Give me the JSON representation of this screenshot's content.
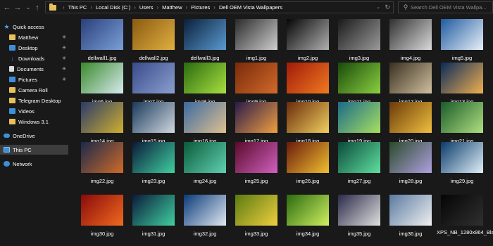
{
  "address": {
    "crumbs": [
      "This PC",
      "Local Disk (C:)",
      "Users",
      "Matthew",
      "Pictures",
      "Dell OEM Vista Wallpapers"
    ]
  },
  "search": {
    "placeholder": "Search Dell OEM Vista Wallpa..."
  },
  "sidebar": {
    "items": [
      {
        "label": "Quick access",
        "icon": "star-icon",
        "pinned": false
      },
      {
        "label": "Matthew",
        "icon": "folder-icon",
        "pinned": true
      },
      {
        "label": "Desktop",
        "icon": "desktop-icon",
        "pinned": true
      },
      {
        "label": "Downloads",
        "icon": "download-icon",
        "pinned": true
      },
      {
        "label": "Documents",
        "icon": "documents-icon",
        "pinned": true
      },
      {
        "label": "Pictures",
        "icon": "pictures-icon",
        "pinned": true
      },
      {
        "label": "Camera Roll",
        "icon": "folder-icon",
        "pinned": false
      },
      {
        "label": "Telegram Desktop",
        "icon": "folder-icon",
        "pinned": false
      },
      {
        "label": "Videos",
        "icon": "videos-icon",
        "pinned": false
      },
      {
        "label": "Windows 3.1",
        "icon": "folder-icon",
        "pinned": false
      },
      {
        "label": "OneDrive",
        "icon": "cloud-icon",
        "pinned": false
      },
      {
        "label": "This PC",
        "icon": "computer-icon",
        "pinned": false,
        "selected": true
      },
      {
        "label": "Network",
        "icon": "network-icon",
        "pinned": false
      }
    ]
  },
  "files": [
    {
      "name": "dellwall1.jpg",
      "colors": [
        "#2a3f7a",
        "#7aa0d8"
      ]
    },
    {
      "name": "dellwall2.jpg",
      "colors": [
        "#8a5a12",
        "#e0b040"
      ]
    },
    {
      "name": "dellwall3.jpg",
      "colors": [
        "#0a1f3a",
        "#5a9ad0"
      ]
    },
    {
      "name": "img1.jpg",
      "colors": [
        "#2a2a2a",
        "#cfcfcf"
      ]
    },
    {
      "name": "img2.jpg",
      "colors": [
        "#050505",
        "#b0b0b0"
      ]
    },
    {
      "name": "img3.jpg",
      "colors": [
        "#1a1a1a",
        "#9a9a9a"
      ]
    },
    {
      "name": "img4.jpg",
      "colors": [
        "#303030",
        "#dadada"
      ]
    },
    {
      "name": "img5.jpg",
      "colors": [
        "#1f5aa0",
        "#e8f0f8"
      ]
    },
    {
      "name": "img6.jpg",
      "colors": [
        "#3a8a2a",
        "#d8eaf0"
      ]
    },
    {
      "name": "img7.jpg",
      "colors": [
        "#3a4a8a",
        "#8aa0d0"
      ]
    },
    {
      "name": "img8.jpg",
      "colors": [
        "#2a6a10",
        "#a8e040"
      ]
    },
    {
      "name": "img9.jpg",
      "colors": [
        "#7a2a0a",
        "#d06a2a"
      ]
    },
    {
      "name": "img10.jpg",
      "colors": [
        "#a01a0a",
        "#f07a20"
      ]
    },
    {
      "name": "img11.jpg",
      "colors": [
        "#1a4a0a",
        "#8ad040"
      ]
    },
    {
      "name": "img12.jpg",
      "colors": [
        "#3a3020",
        "#d0c0a0"
      ]
    },
    {
      "name": "img13.jpg",
      "colors": [
        "#0a2a5a",
        "#f0b050"
      ]
    },
    {
      "name": "img14.jpg",
      "colors": [
        "#2a3a6a",
        "#d0b030"
      ]
    },
    {
      "name": "img15.jpg",
      "colors": [
        "#1a3a5a",
        "#d0d8e0"
      ]
    },
    {
      "name": "img16.jpg",
      "colors": [
        "#3a6aa0",
        "#e0c090"
      ]
    },
    {
      "name": "img17.jpg",
      "colors": [
        "#2a1a4a",
        "#f0a040"
      ]
    },
    {
      "name": "img18.jpg",
      "colors": [
        "#6a2a0a",
        "#f0d060"
      ]
    },
    {
      "name": "img19.jpg",
      "colors": [
        "#1a6a8a",
        "#a8e060"
      ]
    },
    {
      "name": "img20.jpg",
      "colors": [
        "#6a3a0a",
        "#f0c040"
      ]
    },
    {
      "name": "img21.jpg",
      "colors": [
        "#1a5a2a",
        "#b0e080"
      ]
    },
    {
      "name": "img22.jpg",
      "colors": [
        "#1a2a4a",
        "#d06a2a"
      ]
    },
    {
      "name": "img23.jpg",
      "colors": [
        "#0a1a3a",
        "#40d0a0"
      ]
    },
    {
      "name": "img24.jpg",
      "colors": [
        "#0a5a3a",
        "#60d0b0"
      ]
    },
    {
      "name": "img25.jpg",
      "colors": [
        "#5a0a2a",
        "#d060c0"
      ]
    },
    {
      "name": "img26.jpg",
      "colors": [
        "#6a1a0a",
        "#f0c030"
      ]
    },
    {
      "name": "img27.jpg",
      "colors": [
        "#0a4a3a",
        "#60e0a0"
      ]
    },
    {
      "name": "img28.jpg",
      "colors": [
        "#2a4a2a",
        "#b0a0e0"
      ]
    },
    {
      "name": "img29.jpg",
      "colors": [
        "#0a3a6a",
        "#e0f0f8"
      ]
    },
    {
      "name": "img30.jpg",
      "colors": [
        "#8a0a0a",
        "#f06a20"
      ]
    },
    {
      "name": "img31.jpg",
      "colors": [
        "#0a1a3a",
        "#40d0a0"
      ]
    },
    {
      "name": "img32.jpg",
      "colors": [
        "#0a3a7a",
        "#e0e8f0"
      ]
    },
    {
      "name": "img33.jpg",
      "colors": [
        "#5a7a10",
        "#f0d040"
      ]
    },
    {
      "name": "img34.jpg",
      "colors": [
        "#2a6a10",
        "#d0f060"
      ]
    },
    {
      "name": "img35.jpg",
      "colors": [
        "#2a2a4a",
        "#e0e0e0"
      ]
    },
    {
      "name": "img36.jpg",
      "colors": [
        "#5a7aa0",
        "#f0f0f0"
      ]
    },
    {
      "name": "XPS_NB_1280x864_Black.jpg",
      "colors": [
        "#050505",
        "#303030"
      ]
    }
  ]
}
